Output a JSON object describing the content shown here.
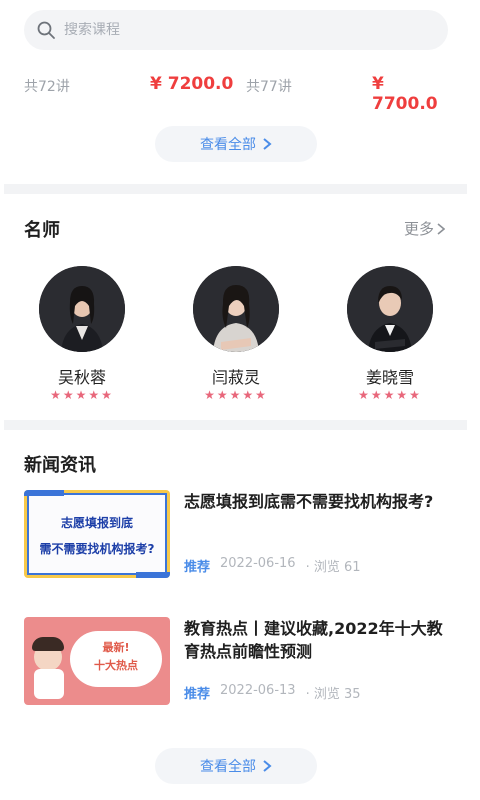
{
  "search": {
    "placeholder": "搜索课程"
  },
  "courses": [
    {
      "lessons": "共72讲",
      "price": "¥ 7200.0"
    },
    {
      "lessons": "共77讲",
      "price": "¥ 7700.0"
    }
  ],
  "view_all_label": "查看全部",
  "teachers_section": {
    "title": "名师",
    "more_label": "更多",
    "teachers": [
      {
        "name": "吴秋蓉",
        "stars": "★★★★★"
      },
      {
        "name": "闫菽灵",
        "stars": "★★★★★"
      },
      {
        "name": "姜晓雪",
        "stars": "★★★★★"
      }
    ]
  },
  "news_section": {
    "title": "新闻资讯",
    "items": [
      {
        "title": "志愿填报到底需不需要找机构报考?",
        "tag": "推荐",
        "date": "2022-06-16",
        "views": "· 浏览 61",
        "thumb_text_1": "志愿填报到底",
        "thumb_text_2": "需不需要找机构报考?"
      },
      {
        "title": "教育热点丨建议收藏,2022年十大教育热点前瞻性预测",
        "tag": "推荐",
        "date": "2022-06-13",
        "views": "· 浏览 35",
        "thumb_text_1": "最新!",
        "thumb_text_2": "十大热点"
      }
    ]
  },
  "colors": {
    "price": "#ef3e3e",
    "accent_blue": "#4a8ce8",
    "star": "#e8677b"
  }
}
